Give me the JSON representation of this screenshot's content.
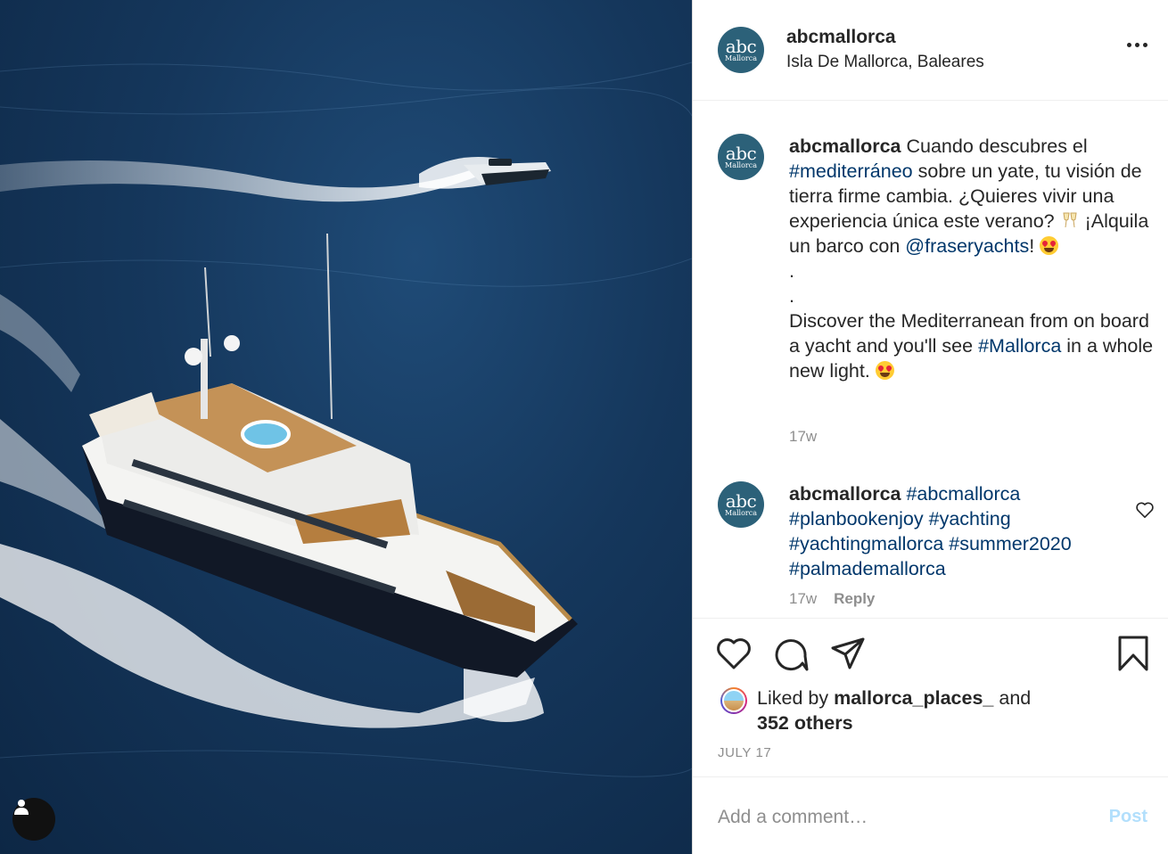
{
  "post": {
    "username": "abcmallorca",
    "location": "Isla De Mallorca, Baleares",
    "avatar_text": {
      "top": "abc",
      "bottom": "Mallorca"
    }
  },
  "caption": {
    "username": "abcmallorca",
    "line1": "Cuando descubres el",
    "hashtag1": "#mediterráneo",
    "line2": "sobre un yate, tu visión de tierra firme cambia. ¿Quieres vivir una experiencia única este verano?",
    "line3": "¡Alquila un barco con",
    "mention": "@fraseryachts",
    "line3_end": "!",
    "dot1": ".",
    "dot2": ".",
    "line4": "Discover the Mediterranean from on board a yacht and you'll see",
    "hashtag2": "#Mallorca",
    "line5": "in a whole new light.",
    "time": "17w"
  },
  "comment2": {
    "username": "abcmallorca",
    "hashtags": [
      "#abcmallorca",
      "#planbookenjoy",
      "#yachting",
      "#yachtingmallorca",
      "#summer2020",
      "#palmademallorca"
    ],
    "time": "17w",
    "reply_label": "Reply"
  },
  "likes": {
    "prefix": "Liked by",
    "user": "mallorca_places_",
    "conj": "and",
    "others": "352 others"
  },
  "date": "JULY 17",
  "comment_box": {
    "placeholder": "Add a comment…",
    "post_label": "Post"
  },
  "colors": {
    "link": "#00376b",
    "muted": "#8e8e8e",
    "post_button": "#b2dffc",
    "avatar_bg": "#2c6179"
  }
}
